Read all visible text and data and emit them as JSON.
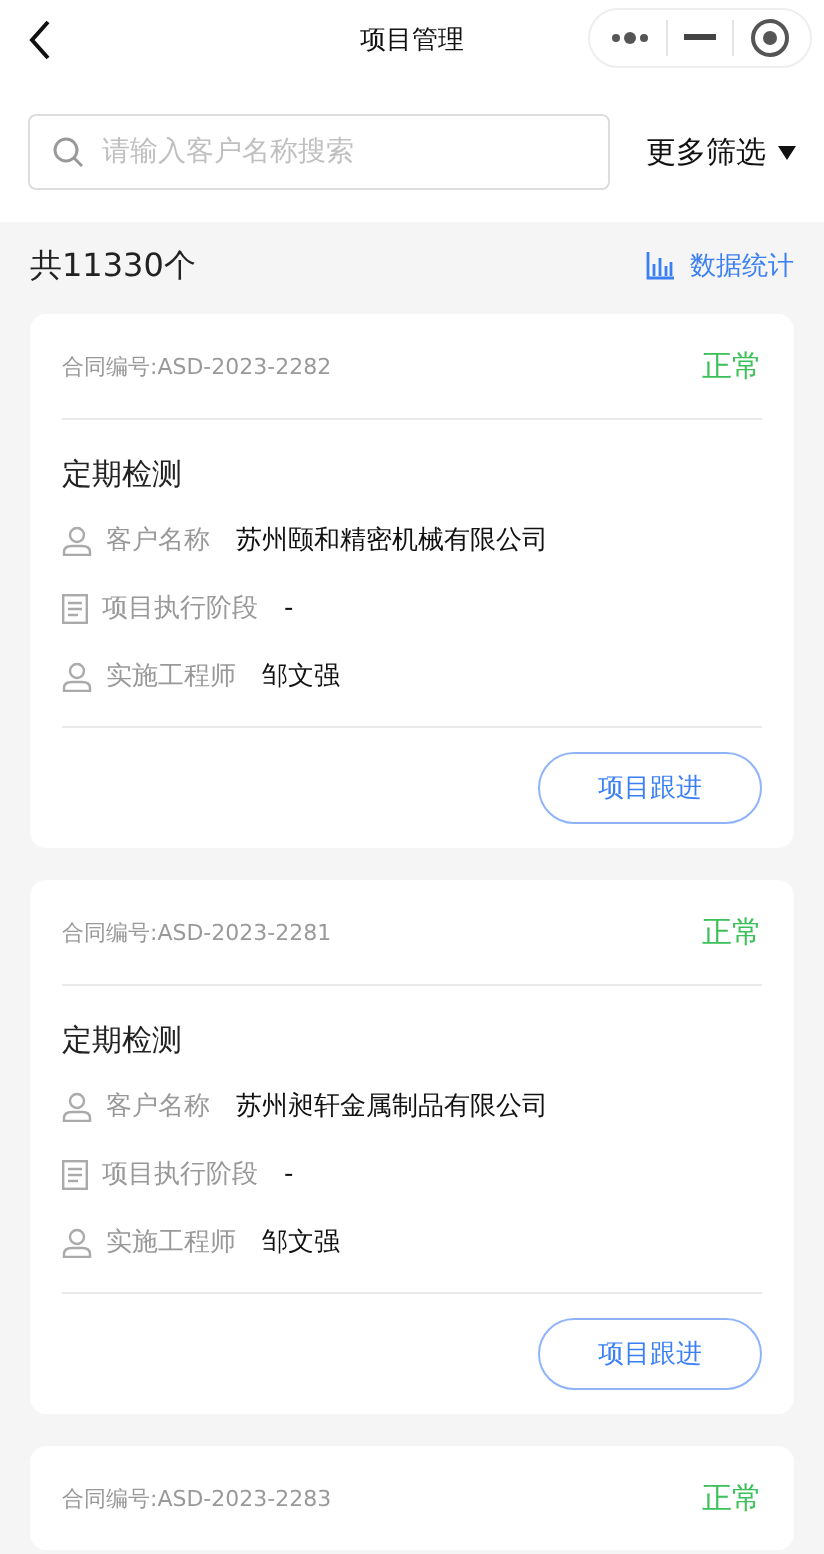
{
  "header": {
    "title": "项目管理"
  },
  "search": {
    "placeholder": "请输入客户名称搜索"
  },
  "filter": {
    "label": "更多筛选"
  },
  "summary": {
    "count": "共11330个",
    "stats_link": "数据统计"
  },
  "cards": [
    {
      "contract": "合同编号:ASD-2023-2282",
      "status": "正常",
      "title": "定期检测",
      "fields": [
        {
          "kind": "person",
          "label": "客户名称",
          "value": "苏州颐和精密机械有限公司"
        },
        {
          "kind": "document",
          "label": "项目执行阶段",
          "value": "-"
        },
        {
          "kind": "person",
          "label": "实施工程师",
          "value": "邹文强"
        }
      ],
      "button": "项目跟进"
    },
    {
      "contract": "合同编号:ASD-2023-2281",
      "status": "正常",
      "title": "定期检测",
      "fields": [
        {
          "kind": "person",
          "label": "客户名称",
          "value": "苏州昶轩金属制品有限公司"
        },
        {
          "kind": "document",
          "label": "项目执行阶段",
          "value": "-"
        },
        {
          "kind": "person",
          "label": "实施工程师",
          "value": "邹文强"
        }
      ],
      "button": "项目跟进"
    },
    {
      "contract": "合同编号:ASD-2023-2283",
      "status": "正常"
    }
  ]
}
